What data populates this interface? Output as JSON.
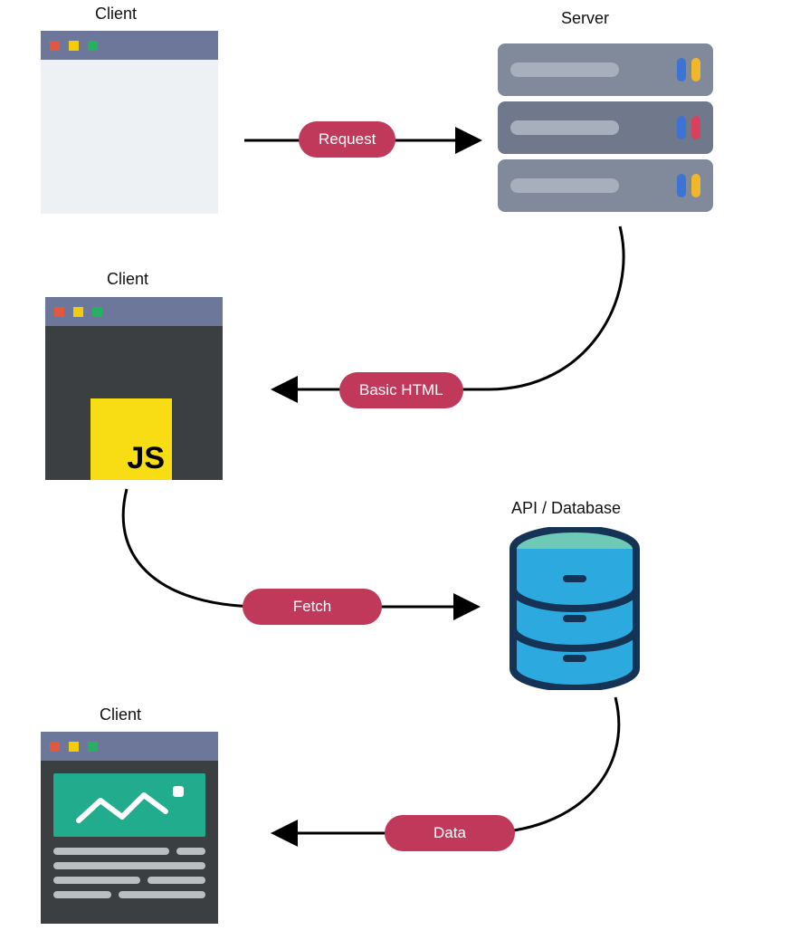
{
  "labels": {
    "client1": "Client",
    "client2": "Client",
    "client3": "Client",
    "server": "Server",
    "api_db": "API / Database"
  },
  "flows": {
    "request": "Request",
    "basic_html": "Basic HTML",
    "fetch": "Fetch",
    "data": "Data"
  },
  "js_badge": "JS",
  "colors": {
    "pill": "#c0395a",
    "titlebar": "#6c7799",
    "window_blank": "#eef1f4",
    "window_dark": "#3b3f41",
    "js_yellow": "#f8dc14",
    "hero_green": "#21ac8e",
    "db_blue": "#2caae0",
    "db_outline": "#143355",
    "server_gray": "#818a9a"
  }
}
